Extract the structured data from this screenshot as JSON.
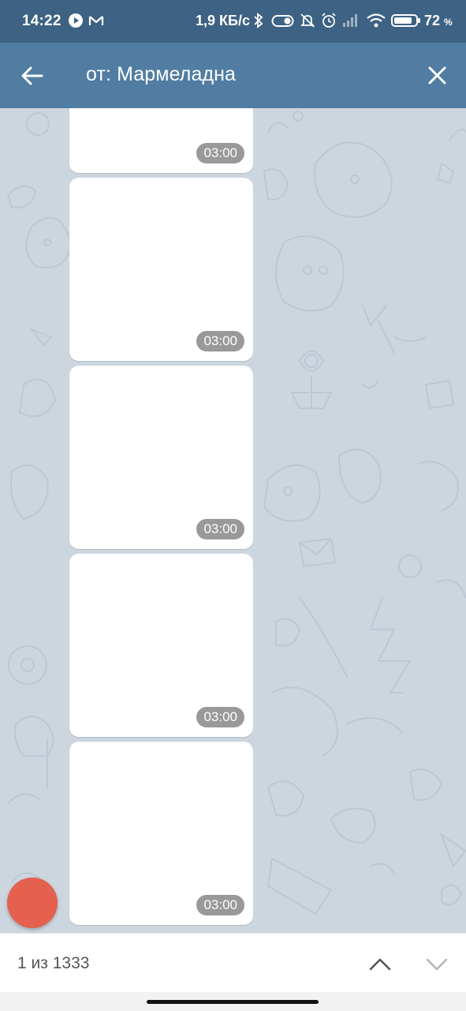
{
  "status_bar": {
    "time": "14:22",
    "speed": "1,9 КБ/с",
    "battery_percent": "72",
    "battery_unit": "%",
    "icons": [
      "play-icon",
      "gmail-icon",
      "bluetooth-icon",
      "toggle-icon",
      "mute-bell-icon",
      "alarm-icon",
      "signal-icon",
      "wifi-icon",
      "battery-icon"
    ]
  },
  "header": {
    "search_query": "от: Мармеладна",
    "back_icon": "arrow-left-icon",
    "close_icon": "close-icon",
    "color": "#517da2"
  },
  "messages": [
    {
      "time": "03:00"
    },
    {
      "time": "03:00"
    },
    {
      "time": "03:00"
    },
    {
      "time": "03:00"
    },
    {
      "time": "03:00"
    }
  ],
  "fab": {
    "color": "#e4604f"
  },
  "search_nav": {
    "counter": "1 из 1333",
    "up_icon": "chevron-up-icon",
    "down_icon": "chevron-down-icon"
  }
}
